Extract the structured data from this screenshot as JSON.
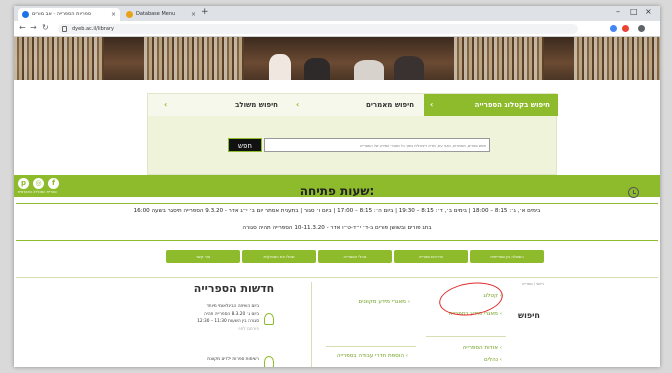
{
  "browser": {
    "tabs": [
      {
        "title": "ספריות הספרייה · אב מורים"
      },
      {
        "title": "Database Menu"
      }
    ],
    "url": "dyeb.ac.il/library",
    "window_controls": [
      "–",
      "□",
      "×"
    ]
  },
  "search_panel": {
    "tabs": [
      {
        "label": "חיפוש בקטלוג הספרייה",
        "active": true
      },
      {
        "label": "חיפוש מאמרים",
        "active": false
      },
      {
        "label": "חיפוש משולב",
        "active": false
      }
    ],
    "search_button": "חפש",
    "search_placeholder": "חפש ספרים, מאמרים, כתבי עת, מדיה דיגיטלית בתוך כל מאגרי המידע של הספרייה"
  },
  "social": {
    "caption": "ספריית המכללה האקדמית",
    "icons": [
      "pinterest-icon",
      "instagram-icon",
      "facebook-icon"
    ]
  },
  "hours": {
    "title": "שעות פתיחה:",
    "schedule": "בימים א׳, ג׳: 8:15 – 18:00 | בימים ב׳, ד׳: 8:15 – 19:30 | ביום ה׳: 8:15 – 17:00 | ביום ו׳ סגור | בתענית אסתר יום ב׳ י״ג אדר - 9.3.20 הספרייה תיסגר בשעה 16:00",
    "note": "בחג פורים ובשושן פורים ב-ד׳ י״ד-ט״ו אדר - 10-11.3.20 הספרייה תהיה סגורה"
  },
  "quick_links": [
    "השאלה בין ספרייתית",
    "הדרכות ספרייה",
    "נוהלי הספרייה",
    "שאלו את הספרן/ית",
    "צור קשר"
  ],
  "news": {
    "title": "חדשות הספרייה",
    "items": [
      {
        "lines": [
          "ביום השיחה הבינלאומי מיוחד",
          "ביום ג׳ 8.3.20 הספרייה תהיה",
          "סגורה בין השעות 11:30 – 12:30"
        ],
        "caption": "פורסם לפני"
      },
      {
        "lines": [
          "רשימות ספרות ילדים מקוונת"
        ],
        "caption": ""
      }
    ]
  },
  "breadcrumb": "ראשי / ספרייה",
  "sidebar_search": {
    "title": "חיפוש",
    "links_col1": [
      "קטלוג",
      "מאגרי מידע בספרייה",
      "אודות הספרייה",
      "נהלים"
    ],
    "links_col2": [
      "מאגרי מידע מקוונים",
      "הוספת חדרי עבודה בספרייה"
    ]
  },
  "colors": {
    "accent": "#8dbb2b",
    "annotation": "#e02a2a"
  }
}
